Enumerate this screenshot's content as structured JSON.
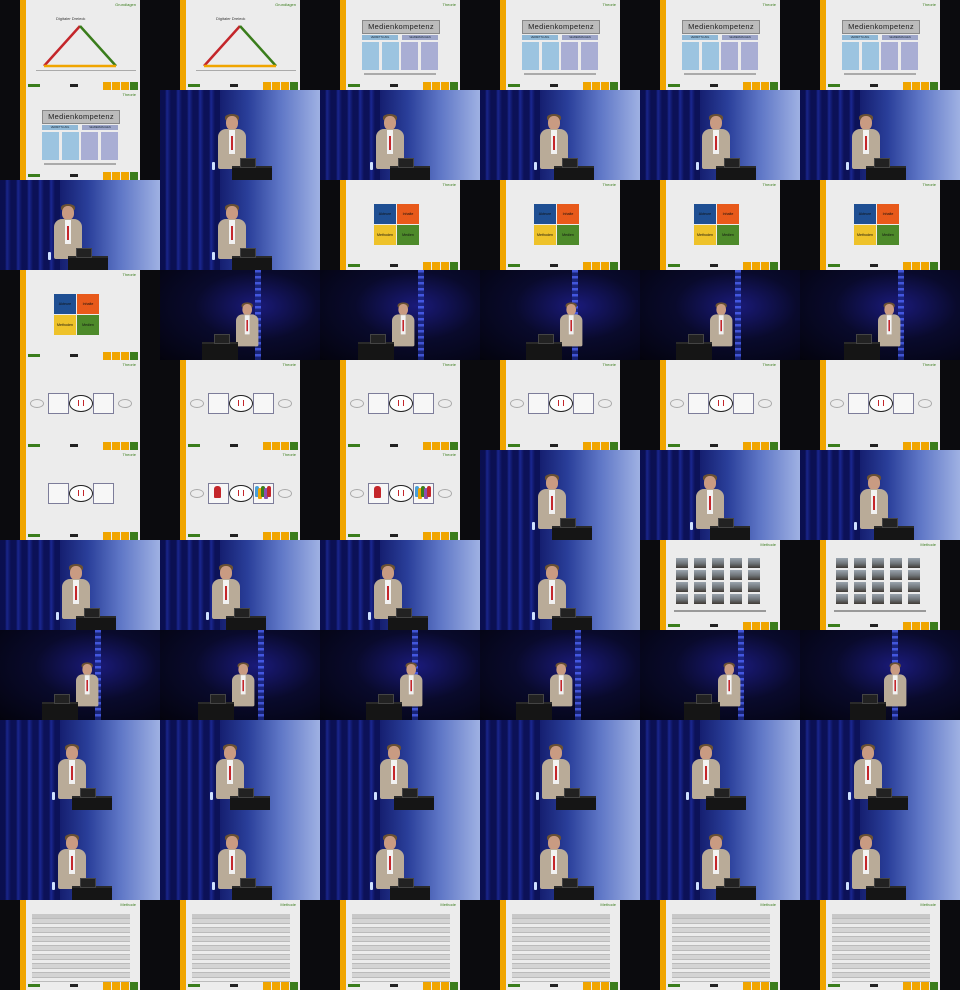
{
  "sheet": {
    "columns": 6,
    "rows": 11
  },
  "slide_text": {
    "grundlagen": "Grundlagen",
    "theorie": "Theorie",
    "methode": "Methode",
    "tri_title": "Digitaler Dreieck",
    "mk_title": "Medienkompetenz",
    "mk_left": "VERMITTLUNG",
    "mk_right": "SELBERMACHEN",
    "quad": [
      "Akteure",
      "Inhalte",
      "Methoden",
      "Medien"
    ]
  },
  "colors": {
    "accent_orange": "#f0a500",
    "accent_green": "#3a7d1c",
    "quad_blue": "#1f4f93",
    "quad_orange": "#e85a1b",
    "quad_yellow": "#eec22a",
    "quad_green": "#4d8a2a",
    "stage_blue": "#1c2a9a"
  },
  "cells": [
    {
      "kind": "slide",
      "layout": "triangle",
      "header": "grundlagen"
    },
    {
      "kind": "slide",
      "layout": "triangle",
      "header": "grundlagen"
    },
    {
      "kind": "slide",
      "layout": "mk",
      "header": "theorie"
    },
    {
      "kind": "slide",
      "layout": "mk",
      "header": "theorie"
    },
    {
      "kind": "slide",
      "layout": "mk",
      "header": "theorie"
    },
    {
      "kind": "slide",
      "layout": "mk",
      "header": "theorie"
    },
    {
      "kind": "slide",
      "layout": "mk",
      "header": "theorie"
    },
    {
      "kind": "photo",
      "stage": "light",
      "pose": 1
    },
    {
      "kind": "photo",
      "stage": "light",
      "pose": 2
    },
    {
      "kind": "photo",
      "stage": "light",
      "pose": 3
    },
    {
      "kind": "photo",
      "stage": "light",
      "pose": 4
    },
    {
      "kind": "photo",
      "stage": "light",
      "pose": 5
    },
    {
      "kind": "photo",
      "stage": "light",
      "pose": 6
    },
    {
      "kind": "photo",
      "stage": "light",
      "pose": 7
    },
    {
      "kind": "slide",
      "layout": "quad",
      "header": "theorie"
    },
    {
      "kind": "slide",
      "layout": "quad",
      "header": "theorie"
    },
    {
      "kind": "slide",
      "layout": "quad",
      "header": "theorie"
    },
    {
      "kind": "slide",
      "layout": "quad",
      "header": "theorie"
    },
    {
      "kind": "slide",
      "layout": "quad",
      "header": "theorie"
    },
    {
      "kind": "photo",
      "stage": "dark",
      "pose": 1
    },
    {
      "kind": "photo",
      "stage": "dark",
      "pose": 2
    },
    {
      "kind": "photo",
      "stage": "dark",
      "pose": 3
    },
    {
      "kind": "photo",
      "stage": "dark",
      "pose": 4
    },
    {
      "kind": "photo",
      "stage": "dark",
      "pose": 5
    },
    {
      "kind": "slide",
      "layout": "process",
      "header": "theorie"
    },
    {
      "kind": "slide",
      "layout": "process",
      "header": "theorie"
    },
    {
      "kind": "slide",
      "layout": "process",
      "header": "theorie"
    },
    {
      "kind": "slide",
      "layout": "process",
      "header": "theorie"
    },
    {
      "kind": "slide",
      "layout": "process",
      "header": "theorie"
    },
    {
      "kind": "slide",
      "layout": "process",
      "header": "theorie"
    },
    {
      "kind": "slide",
      "layout": "process2",
      "header": "theorie"
    },
    {
      "kind": "slide",
      "layout": "people",
      "header": "theorie"
    },
    {
      "kind": "slide",
      "layout": "people",
      "header": "theorie"
    },
    {
      "kind": "photo",
      "stage": "light",
      "pose": 1
    },
    {
      "kind": "photo",
      "stage": "light",
      "pose": 2
    },
    {
      "kind": "photo",
      "stage": "light",
      "pose": 3
    },
    {
      "kind": "photo",
      "stage": "light",
      "pose": 4
    },
    {
      "kind": "photo",
      "stage": "light",
      "pose": 5
    },
    {
      "kind": "photo",
      "stage": "light",
      "pose": 6
    },
    {
      "kind": "photo",
      "stage": "light",
      "pose": 7
    },
    {
      "kind": "slide",
      "layout": "photos",
      "header": "methode"
    },
    {
      "kind": "slide",
      "layout": "photos",
      "header": "methode"
    },
    {
      "kind": "photo",
      "stage": "dark",
      "pose": 1
    },
    {
      "kind": "photo",
      "stage": "dark",
      "pose": 2
    },
    {
      "kind": "photo",
      "stage": "dark",
      "pose": 3
    },
    {
      "kind": "photo",
      "stage": "dark",
      "pose": 4
    },
    {
      "kind": "photo",
      "stage": "dark",
      "pose": 5
    },
    {
      "kind": "photo",
      "stage": "dark",
      "pose": 6
    },
    {
      "kind": "photo",
      "stage": "light",
      "pose": 1
    },
    {
      "kind": "photo",
      "stage": "light",
      "pose": 2
    },
    {
      "kind": "photo",
      "stage": "light",
      "pose": 3
    },
    {
      "kind": "photo",
      "stage": "light",
      "pose": 4
    },
    {
      "kind": "photo",
      "stage": "light",
      "pose": 5
    },
    {
      "kind": "photo",
      "stage": "light",
      "pose": 6
    },
    {
      "kind": "photo",
      "stage": "light",
      "pose": 7
    },
    {
      "kind": "photo",
      "stage": "light",
      "pose": 1
    },
    {
      "kind": "photo",
      "stage": "light",
      "pose": 2
    },
    {
      "kind": "photo",
      "stage": "light",
      "pose": 3
    },
    {
      "kind": "photo",
      "stage": "light",
      "pose": 4
    },
    {
      "kind": "photo",
      "stage": "light",
      "pose": 5
    },
    {
      "kind": "slide",
      "layout": "table",
      "header": "methode"
    },
    {
      "kind": "slide",
      "layout": "table",
      "header": "methode"
    },
    {
      "kind": "slide",
      "layout": "table",
      "header": "methode"
    },
    {
      "kind": "slide",
      "layout": "table",
      "header": "methode"
    },
    {
      "kind": "slide",
      "layout": "table",
      "header": "methode"
    },
    {
      "kind": "slide",
      "layout": "table",
      "header": "methode"
    }
  ]
}
